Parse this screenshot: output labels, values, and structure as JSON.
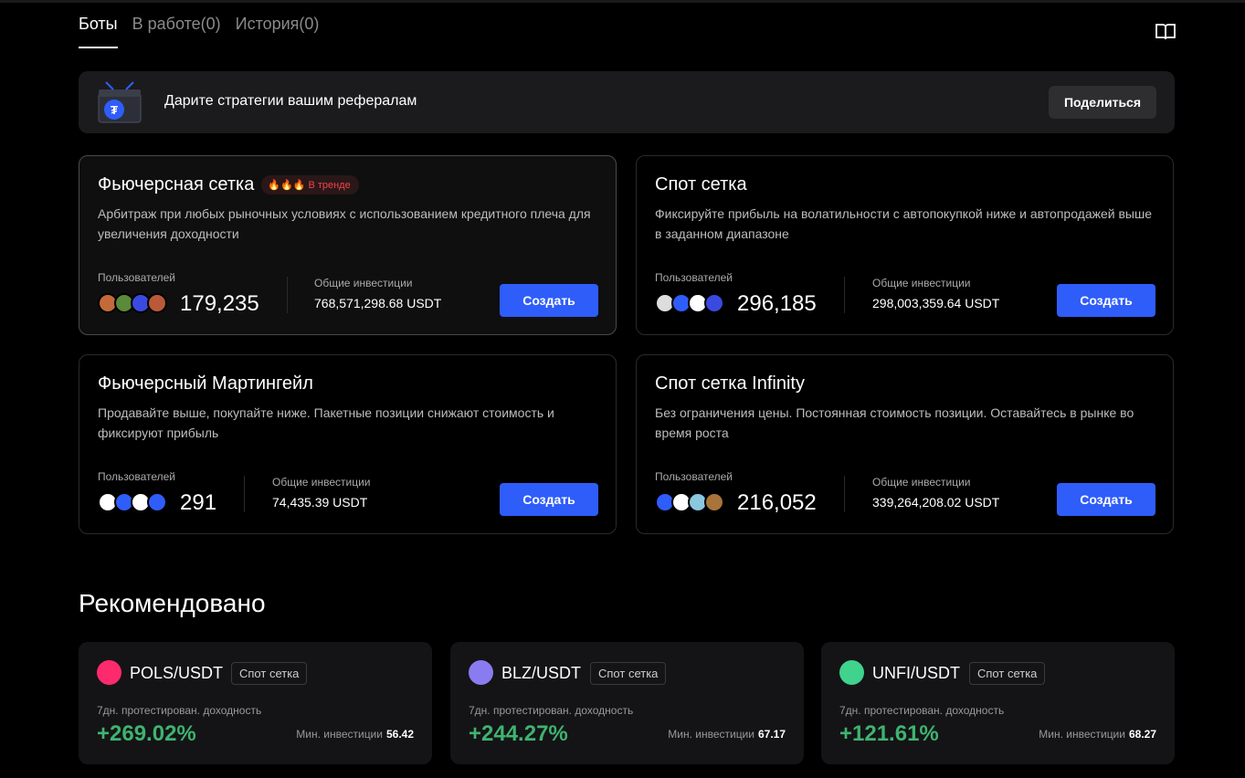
{
  "tabs": {
    "bots": "Боты",
    "working": "В работе(0)",
    "history": "История(0)"
  },
  "banner": {
    "text": "Дарите стратегии вашим рефералам",
    "share": "Поделиться"
  },
  "cards": [
    {
      "title": "Фьючерсная сетка",
      "badge": "В тренде",
      "desc": "Арбитраж при любых рыночных условиях с использованием кредитного плеча для увеличения доходности",
      "users_label": "Пользователей",
      "users": "179,235",
      "invest_label": "Общие инвестиции",
      "invest": "768,571,298.68 USDT",
      "button": "Создать"
    },
    {
      "title": "Спот сетка",
      "desc": "Фиксируйте прибыль на волатильности с автопокупкой ниже и автопродажей выше в заданном диапазоне",
      "users_label": "Пользователей",
      "users": "296,185",
      "invest_label": "Общие инвестиции",
      "invest": "298,003,359.64 USDT",
      "button": "Создать"
    },
    {
      "title": "Фьючерсный Мартингейл",
      "desc": "Продавайте выше, покупайте ниже. Пакетные позиции снижают стоимость и фиксируют прибыль",
      "users_label": "Пользователей",
      "users": "291",
      "invest_label": "Общие инвестиции",
      "invest": "74,435.39 USDT",
      "button": "Создать"
    },
    {
      "title": "Спот сетка Infinity",
      "desc": "Без ограничения цены. Постоянная стоимость позиции. Оставайтесь в рынке во время роста",
      "users_label": "Пользователей",
      "users": "216,052",
      "invest_label": "Общие инвестиции",
      "invest": "339,264,208.02 USDT",
      "button": "Создать"
    }
  ],
  "recommended": {
    "title": "Рекомендовано",
    "items": [
      {
        "pair": "POLS/USDT",
        "type": "Спот сетка",
        "label": "7дн. протестирован. доходность",
        "pct": "+269.02%",
        "min_label": "Мин. инвестиции",
        "min": "56.42",
        "coin_color": "#ff2a6d"
      },
      {
        "pair": "BLZ/USDT",
        "type": "Спот сетка",
        "label": "7дн. протестирован. доходность",
        "pct": "+244.27%",
        "min_label": "Мин. инвестиции",
        "min": "67.17",
        "coin_color": "#8a7cf0"
      },
      {
        "pair": "UNFI/USDT",
        "type": "Спот сетка",
        "label": "7дн. протестирован. доходность",
        "pct": "+121.61%",
        "min_label": "Мин. инвестиции",
        "min": "68.27",
        "coin_color": "#3fd38e"
      }
    ]
  },
  "colors": {
    "accent": "#2f5dfa",
    "positive": "#3fb370",
    "trend": "#f0444a"
  },
  "icons": [
    "book-icon",
    "gift-icon",
    "tether-icon",
    "fire-icon",
    "avatar",
    "pols-icon",
    "blz-icon",
    "unfi-icon"
  ]
}
